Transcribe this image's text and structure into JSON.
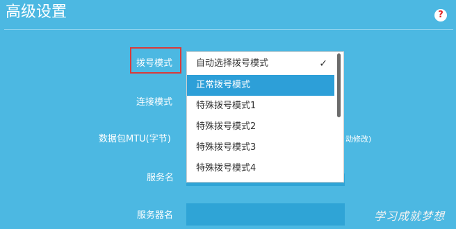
{
  "header": {
    "title": "高级设置",
    "help_icon": "question-icon",
    "help_label": "?"
  },
  "form": {
    "dial_mode_label": "拨号模式",
    "connect_mode_label": "连接模式",
    "mtu_label": "数据包MTU(字节)",
    "mtu_hint": "动修改)",
    "service_name_label": "服务名",
    "server_name_label": "服务器名"
  },
  "dropdown": {
    "options": [
      {
        "label": "自动选择拨号模式",
        "checked": true
      },
      {
        "label": "正常拨号模式",
        "highlighted": true
      },
      {
        "label": "特殊拨号模式1"
      },
      {
        "label": "特殊拨号模式2"
      },
      {
        "label": "特殊拨号模式3"
      },
      {
        "label": "特殊拨号模式4"
      }
    ],
    "check_glyph": "✓"
  },
  "watermark": {
    "text": "学习成就梦想"
  },
  "colors": {
    "background": "#4cb8e2",
    "highlight": "#2d9fd8",
    "field": "#2fa4d6",
    "label_box_border": "#d93a3a",
    "help_icon_text": "#e02828"
  }
}
